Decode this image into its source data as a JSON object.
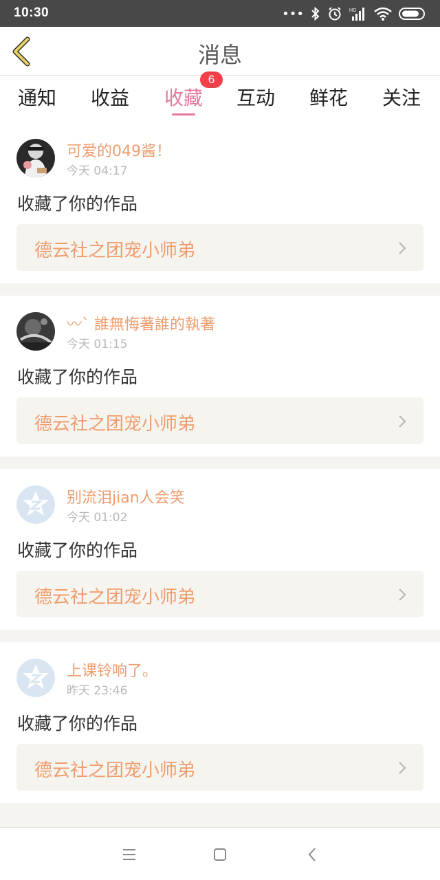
{
  "status": {
    "time": "10:30",
    "dots": "•••"
  },
  "header": {
    "title": "消息"
  },
  "tabs": [
    {
      "label": "通知",
      "active": false
    },
    {
      "label": "收益",
      "active": false
    },
    {
      "label": "收藏",
      "active": true
    },
    {
      "label": "互动",
      "active": false
    },
    {
      "label": "鲜花",
      "active": false
    },
    {
      "label": "关注",
      "active": false
    }
  ],
  "badge": {
    "count": "6"
  },
  "messages": [
    {
      "username": "可爱的049酱！",
      "time": "今天 04:17",
      "action": "收藏了你的作品",
      "work_title": "德云社之团宠小师弟",
      "avatar": "photo-girl"
    },
    {
      "username": "〰ˋ  誰無悔著誰的執著",
      "time": "今天 01:15",
      "action": "收藏了你的作品",
      "work_title": "德云社之团宠小师弟",
      "avatar": "photo-dark"
    },
    {
      "username": "别流泪jian人会笑",
      "time": "今天 01:02",
      "action": "收藏了你的作品",
      "work_title": "德云社之团宠小师弟",
      "avatar": "default-z"
    },
    {
      "username": "上课铃响了。",
      "time": "昨天 23:46",
      "action": "收藏了你的作品",
      "work_title": "德云社之团宠小师弟",
      "avatar": "default-z"
    }
  ],
  "colors": {
    "accent": "#e4779f",
    "username": "#ef9d6e",
    "badge": "#f2404b",
    "back_icon": "#d6c24a"
  }
}
